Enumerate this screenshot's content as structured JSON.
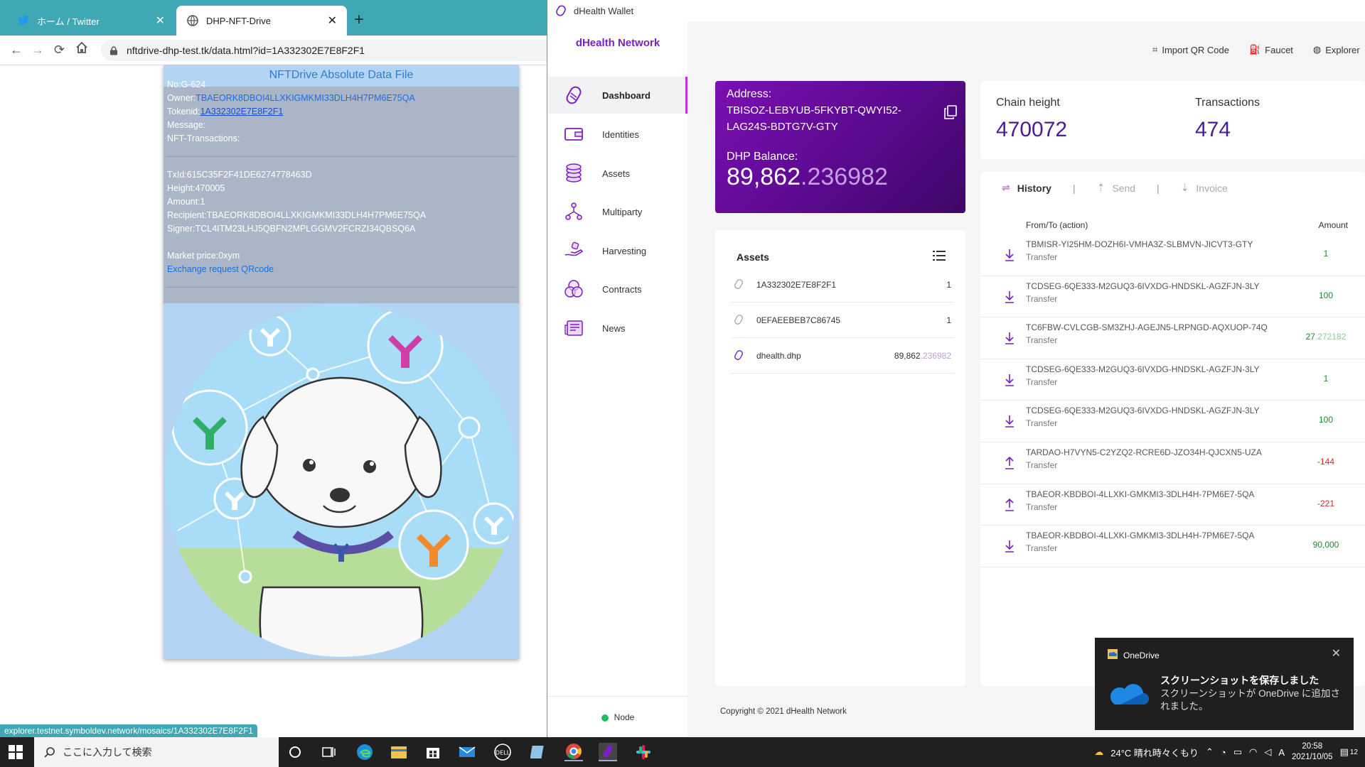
{
  "browser": {
    "tabs": [
      {
        "label": "ホーム / Twitter",
        "icon": "twitter-icon"
      },
      {
        "label": "DHP-NFT-Drive",
        "icon": "globe-icon"
      }
    ],
    "new_tab": "+",
    "close": "✕",
    "url": "nftdrive-dhp-test.tk/data.html?id=1A332302E7E8F2F1",
    "status_url": "explorer.testnet.symboldev.network/mosaics/1A332302E7E8F2F1"
  },
  "nft": {
    "title": "NFTDrive Absolute Data File",
    "no": "No:G-624",
    "owner_label": "Owner:",
    "owner_value": "TBAEORK8DBOI4LLXKIGMKMI33DLH4H7PM6E75QA",
    "tokenid_label": "Tokenid:",
    "tokenid_value": "1A332302E7E8F2F1",
    "message": "Message:",
    "nft_tx": "NFT-Transactions:",
    "txid": "TxId:615C35F2F41DE6274778463D",
    "height": "Height:470005",
    "amount": "Amount:1",
    "recipient": "Recipient:TBAEORK8DBOI4LLXKIGMKMI33DLH4H7PM6E75QA",
    "signer": "Signer:TCL4ITM23LHJ5QBFN2MPLGGMV2FCRZI34QBSQ6A",
    "market_price": "Market price:0xym",
    "exchange_link": "Exchange request QRcode"
  },
  "wallet": {
    "window_title": "dHealth Wallet",
    "brand": "dHealth Network",
    "nav": [
      {
        "label": "Dashboard",
        "icon": "dashboard-icon",
        "active": true
      },
      {
        "label": "Identities",
        "icon": "identities-icon"
      },
      {
        "label": "Assets",
        "icon": "assets-icon"
      },
      {
        "label": "Multiparty",
        "icon": "multiparty-icon"
      },
      {
        "label": "Harvesting",
        "icon": "harvesting-icon"
      },
      {
        "label": "Contracts",
        "icon": "contracts-icon"
      },
      {
        "label": "News",
        "icon": "news-icon"
      }
    ],
    "node_label": "Node",
    "top_actions": {
      "import_qr": "Import QR Code",
      "faucet": "Faucet",
      "explorer": "Explorer"
    },
    "address_label": "Address:",
    "address_value": "TBISOZ-LEBYUB-5FKYBT-QWYI52-LAG24S-BDTG7V-GTY",
    "balance_label": "DHP Balance:",
    "balance_int": "89,862",
    "balance_dec": ".236982",
    "chain_height_label": "Chain height",
    "chain_height_value": "470072",
    "transactions_label": "Transactions",
    "transactions_value": "474",
    "assets_title": "Assets",
    "assets": [
      {
        "name": "1A332302E7E8F2F1",
        "amount_int": "1",
        "amount_dec": ""
      },
      {
        "name": "0EFAEEBEB7C86745",
        "amount_int": "1",
        "amount_dec": ""
      },
      {
        "name": "dhealth.dhp",
        "amount_int": "89,862",
        "amount_dec": ".236982"
      }
    ],
    "history_tabs": {
      "history": "History",
      "send": "Send",
      "invoice": "Invoice"
    },
    "history_col_from": "From/To (action)",
    "history_col_amount": "Amount",
    "history": [
      {
        "addr": "TBMISR-YI25HM-DOZH6I-VMHA3Z-SLBMVN-JICVT3-GTY",
        "type": "Transfer",
        "dir": "in",
        "amount_int": "1",
        "amount_dec": ""
      },
      {
        "addr": "TCDSEG-6QE333-M2GUQ3-6IVXDG-HNDSKL-AGZFJN-3LY",
        "type": "Transfer",
        "dir": "in",
        "amount_int": "100",
        "amount_dec": ""
      },
      {
        "addr": "TC6FBW-CVLCGB-SM3ZHJ-AGEJN5-LRPNGD-AQXUOP-74Q",
        "type": "Transfer",
        "dir": "in",
        "amount_int": "27",
        "amount_dec": ".272182"
      },
      {
        "addr": "TCDSEG-6QE333-M2GUQ3-6IVXDG-HNDSKL-AGZFJN-3LY",
        "type": "Transfer",
        "dir": "in",
        "amount_int": "1",
        "amount_dec": ""
      },
      {
        "addr": "TCDSEG-6QE333-M2GUQ3-6IVXDG-HNDSKL-AGZFJN-3LY",
        "type": "Transfer",
        "dir": "in",
        "amount_int": "100",
        "amount_dec": ""
      },
      {
        "addr": "TARDAO-H7VYN5-C2YZQ2-RCRE6D-JZO34H-QJCXN5-UZA",
        "type": "Transfer",
        "dir": "out",
        "amount_int": "-144",
        "amount_dec": ""
      },
      {
        "addr": "TBAEOR-KBDBOI-4LLXKI-GMKMI3-3DLH4H-7PM6E7-5QA",
        "type": "Transfer",
        "dir": "out",
        "amount_int": "-221",
        "amount_dec": ""
      },
      {
        "addr": "TBAEOR-KBDBOI-4LLXKI-GMKMI3-3DLH4H-7PM6E7-5QA",
        "type": "Transfer",
        "dir": "in",
        "amount_int": "90,000",
        "amount_dec": ""
      }
    ],
    "copyright": "Copyright © 2021 dHealth Network"
  },
  "toast": {
    "app": "OneDrive",
    "title": "スクリーンショットを保存しました",
    "message": "スクリーンショットが OneDrive に追加されました。",
    "close": "✕"
  },
  "taskbar": {
    "search_placeholder": "ここに入力して検索",
    "weather": "24°C 晴れ時々くもり",
    "ime": "A",
    "time": "20:58",
    "date": "2021/10/05",
    "notifications": "12"
  },
  "colors": {
    "chrome_tab": "#3fa8b4",
    "brand_purple": "#7a1fc2",
    "positive": "#1b8a2e",
    "negative": "#c92a2a"
  }
}
